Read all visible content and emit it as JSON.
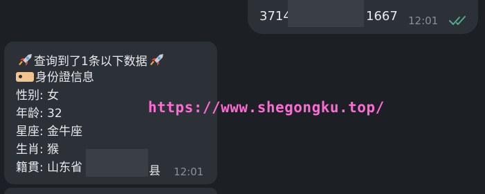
{
  "outgoing": {
    "text_start": "3714",
    "text_end": "1667",
    "time": "12:01",
    "status_icon": "double-check-icon",
    "status_color": "#4fae8e"
  },
  "incoming": {
    "lines": [
      "查询到了1条以下数据",
      "身份證信息",
      "性别: 女",
      "年龄: 32",
      "星座: 金牛座",
      "生肖: 猴",
      "籍貫: 山东省"
    ],
    "suffix": "县",
    "time": "12:01",
    "icons": [
      "rocket-icon",
      "tag-icon"
    ]
  },
  "watermark": {
    "text": "https://www.shegongku.top/",
    "color": "#ff6ad5"
  }
}
